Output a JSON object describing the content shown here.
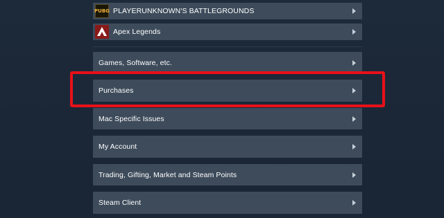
{
  "games": [
    {
      "label": "PLAYERUNKNOWN'S BATTLEGROUNDS",
      "icon": "pubg-game-icon",
      "icon_text": "PUBG"
    },
    {
      "label": "Apex Legends",
      "icon": "apex-legends-game-icon"
    }
  ],
  "categories": [
    {
      "label": "Games, Software, etc."
    },
    {
      "label": "Purchases"
    },
    {
      "label": "Mac Specific Issues"
    },
    {
      "label": "My Account"
    },
    {
      "label": "Trading, Gifting, Market and Steam Points"
    },
    {
      "label": "Steam Client"
    }
  ],
  "highlight_color": "#e8101a",
  "row_color": "#3d4b5b",
  "background_color": "#1b2838"
}
